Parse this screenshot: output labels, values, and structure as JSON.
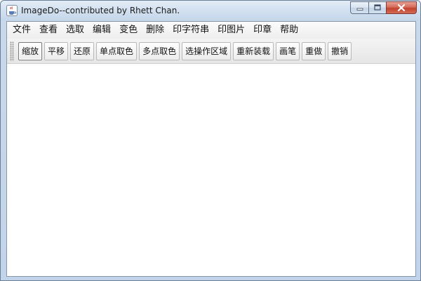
{
  "window": {
    "title": "ImageDo--contributed by Rhett Chan."
  },
  "menubar": {
    "items": [
      "文件",
      "查看",
      "选取",
      "编辑",
      "变色",
      "删除",
      "印字符串",
      "印图片",
      "印章",
      "帮助"
    ]
  },
  "toolbar": {
    "buttons": [
      "缩放",
      "平移",
      "还原",
      "单点取色",
      "多点取色",
      "选操作区域",
      "重新装载",
      "画笔",
      "重做",
      "撤销"
    ],
    "active_index": 0
  },
  "icons": {
    "app": "java-cup-icon",
    "minimize": "minimize-icon",
    "maximize": "maximize-icon",
    "close": "close-icon"
  },
  "colors": {
    "close_button": "#c2432f",
    "title_bar": "#d3e1f0"
  }
}
